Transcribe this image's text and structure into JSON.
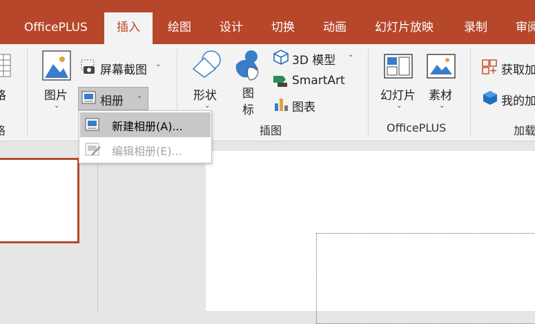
{
  "tabs": [
    {
      "label": "OfficePLUS",
      "active": false
    },
    {
      "label": "插入",
      "active": true
    },
    {
      "label": "绘图",
      "active": false
    },
    {
      "label": "设计",
      "active": false
    },
    {
      "label": "切换",
      "active": false
    },
    {
      "label": "动画",
      "active": false
    },
    {
      "label": "幻灯片放映",
      "active": false
    },
    {
      "label": "录制",
      "active": false
    },
    {
      "label": "审阅",
      "active": false
    }
  ],
  "ribbon": {
    "left_partial_label": "格",
    "left_partial_group": "格",
    "images": {
      "picture": "图片",
      "screenshot": "屏幕截图",
      "album": "相册"
    },
    "illustrations": {
      "shapes": "形状",
      "icons": "图标",
      "model_3d": "3D 模型",
      "smartart": "SmartArt",
      "chart": "图表",
      "group_label": "插图"
    },
    "officeplus": {
      "slides": "幻灯片",
      "material": "素材",
      "group_label": "OfficePLUS"
    },
    "addins": {
      "get_addins": "获取加",
      "my_addins": "我的加",
      "group_label": "加载"
    }
  },
  "album_menu": {
    "items": [
      {
        "label": "新建相册(A)...",
        "enabled": true,
        "highlighted": true
      },
      {
        "label": "编辑相册(E)...",
        "enabled": false,
        "highlighted": false
      }
    ]
  },
  "colors": {
    "accent": "#b7472a",
    "ribbon_bg": "#f3f3f3",
    "workspace_bg": "#e6e6e6"
  }
}
